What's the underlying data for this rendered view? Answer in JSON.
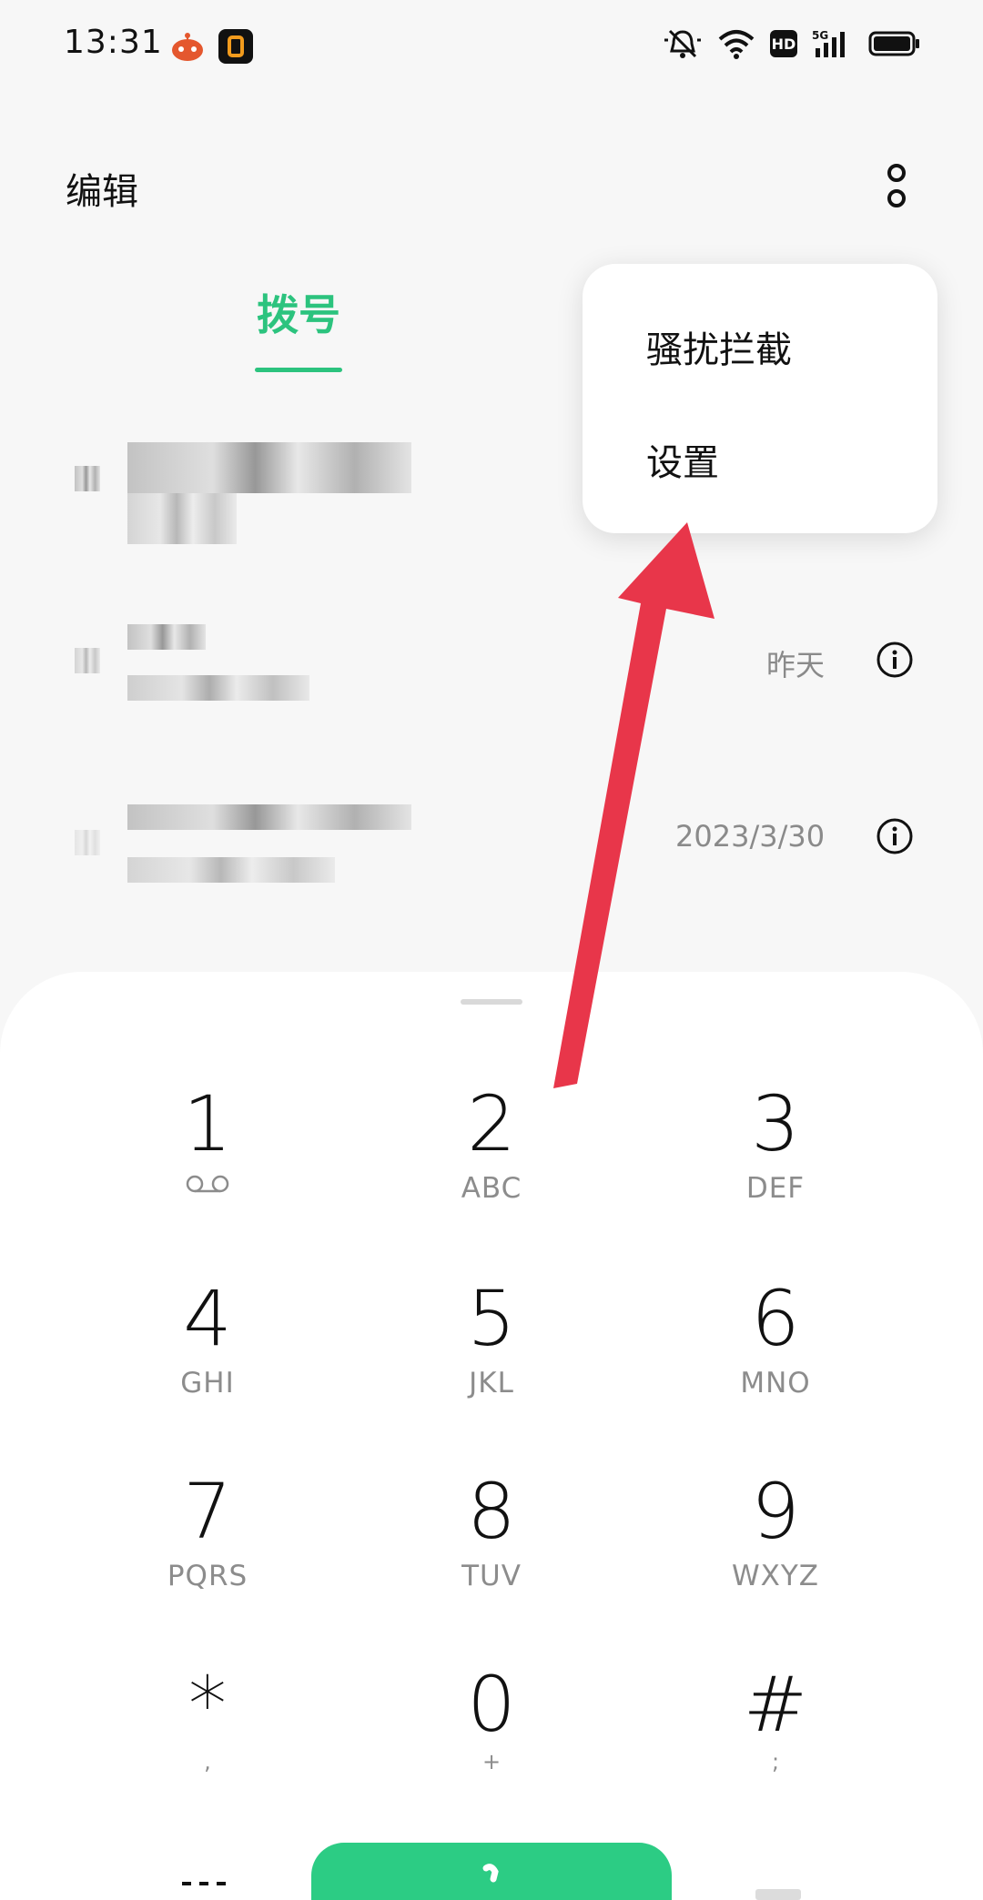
{
  "status_bar": {
    "time": "13:31",
    "hd_badge": "HD",
    "network": "5G"
  },
  "top_bar": {
    "edit_label": "编辑"
  },
  "tabs": [
    {
      "label": "拨号",
      "active": true
    }
  ],
  "popup_menu": {
    "items": [
      {
        "label": "骚扰拦截"
      },
      {
        "label": "设置"
      }
    ]
  },
  "call_log": [
    {
      "time": ""
    },
    {
      "time": "昨天"
    },
    {
      "time": "2023/3/30"
    }
  ],
  "dialpad": {
    "keys": [
      {
        "digit": "1",
        "letters": ""
      },
      {
        "digit": "2",
        "letters": "ABC"
      },
      {
        "digit": "3",
        "letters": "DEF"
      },
      {
        "digit": "4",
        "letters": "GHI"
      },
      {
        "digit": "5",
        "letters": "JKL"
      },
      {
        "digit": "6",
        "letters": "MNO"
      },
      {
        "digit": "7",
        "letters": "PQRS"
      },
      {
        "digit": "8",
        "letters": "TUV"
      },
      {
        "digit": "9",
        "letters": "WXYZ"
      },
      {
        "digit": "*",
        "letters": ","
      },
      {
        "digit": "0",
        "letters": "+"
      },
      {
        "digit": "#",
        "letters": ";"
      }
    ]
  },
  "colors": {
    "accent_green": "#2cc37e",
    "call_button": "#2ccc84",
    "annotation_arrow": "#e8364a"
  },
  "icons": {
    "more": "more-vertical-icon",
    "info": "info-icon",
    "voicemail": "voicemail-icon",
    "call": "phone-icon"
  }
}
